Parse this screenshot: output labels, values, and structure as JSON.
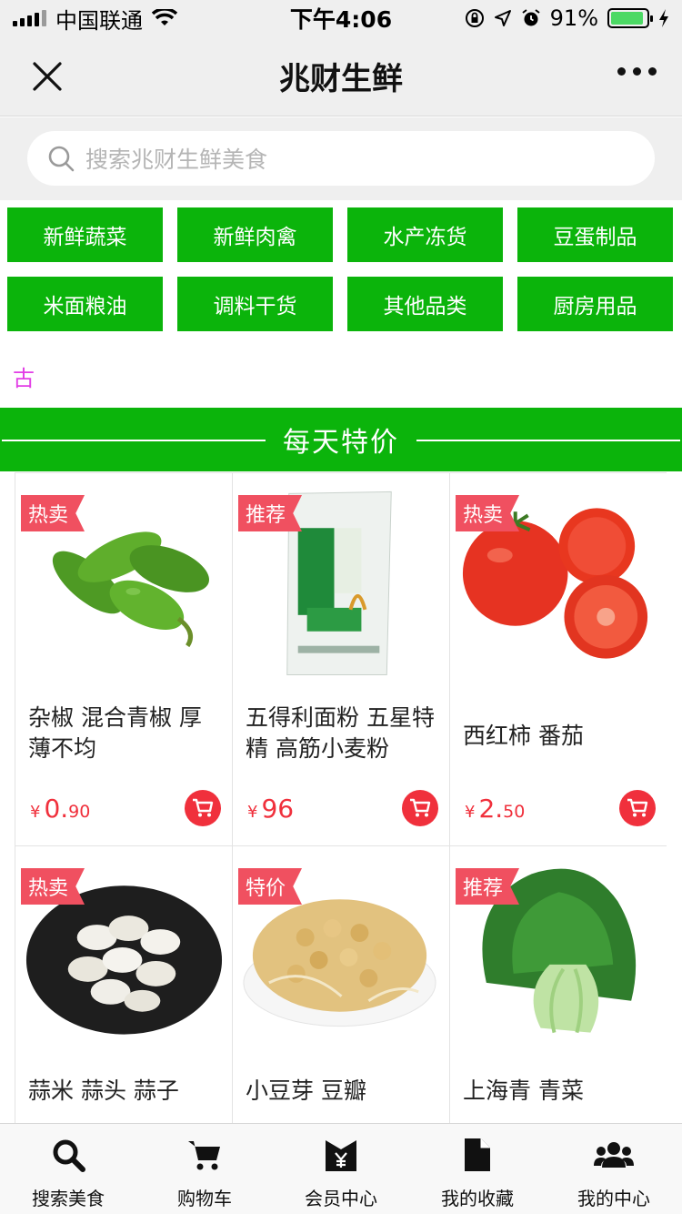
{
  "status_bar": {
    "carrier": "中国联通",
    "time": "下午4:06",
    "battery": "91%",
    "battery_level": 0.91
  },
  "header": {
    "title": "兆财生鲜"
  },
  "search": {
    "placeholder": "搜索兆财生鲜美食"
  },
  "categories": [
    "新鲜蔬菜",
    "新鲜肉禽",
    "水产冻货",
    "豆蛋制品",
    "米面粮油",
    "调料干货",
    "其他品类",
    "厨房用品"
  ],
  "marquee": {
    "text": "古"
  },
  "section": {
    "title": "每天特价"
  },
  "products": [
    {
      "badge": "热卖",
      "name": "杂椒 混合青椒 厚薄不均",
      "price_yen": "¥",
      "price_int": "0.",
      "price_dec": "90"
    },
    {
      "badge": "推荐",
      "name": "五得利面粉 五星特精 高筋小麦粉",
      "price_yen": "¥",
      "price_int": "96",
      "price_dec": ""
    },
    {
      "badge": "热卖",
      "name": "西红柿 番茄",
      "price_yen": "¥",
      "price_int": "2.",
      "price_dec": "50"
    },
    {
      "badge": "热卖",
      "name": "蒜米 蒜头 蒜子"
    },
    {
      "badge": "特价",
      "name": "小豆芽 豆瓣"
    },
    {
      "badge": "推荐",
      "name": "上海青 青菜"
    }
  ],
  "tabbar": [
    "搜索美食",
    "购物车",
    "会员中心",
    "我的收藏",
    "我的中心"
  ],
  "colors": {
    "brand_green": "#0bb40b",
    "price_red": "#f0303c",
    "badge_red": "#f05060"
  }
}
